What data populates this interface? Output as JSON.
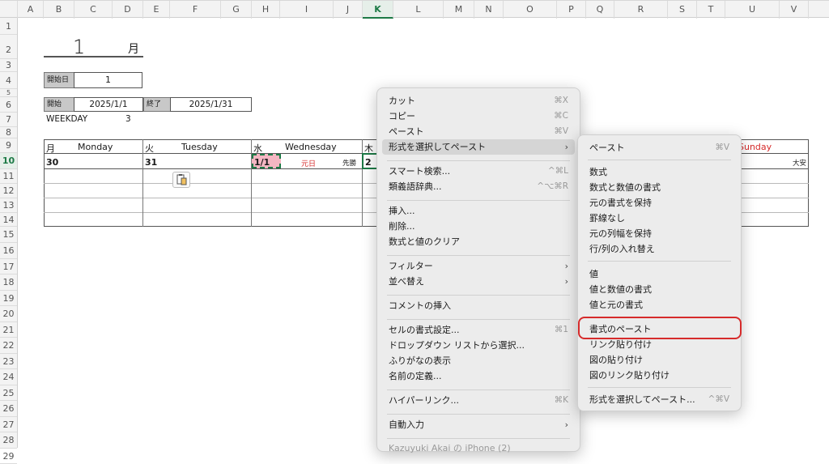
{
  "columns": [
    "A",
    "B",
    "C",
    "D",
    "E",
    "F",
    "G",
    "H",
    "I",
    "J",
    "K",
    "L",
    "M",
    "N",
    "O",
    "P",
    "Q",
    "R",
    "S",
    "T",
    "U",
    "V"
  ],
  "selected_column": "K",
  "rows": [
    "1",
    "2",
    "3",
    "4",
    "5",
    "6",
    "7",
    "8",
    "9",
    "10",
    "11",
    "12",
    "13",
    "14",
    "15",
    "16",
    "17",
    "18",
    "19",
    "20",
    "21",
    "22",
    "23",
    "24",
    "25",
    "26",
    "27",
    "28",
    "29"
  ],
  "selected_row": "10",
  "sheet": {
    "month_number": "1",
    "month_label": "月",
    "start_day_label": "開始日",
    "start_day_value": "1",
    "start_label": "開始",
    "start_value": "2025/1/1",
    "end_label": "終了",
    "end_value": "2025/1/31",
    "weekday_label": "WEEKDAY",
    "weekday_value": "3",
    "days": [
      {
        "kanji": "月",
        "name": "Monday"
      },
      {
        "kanji": "火",
        "name": "Tuesday"
      },
      {
        "kanji": "水",
        "name": "Wednesday"
      },
      {
        "kanji": "木",
        "name": ""
      }
    ],
    "sunday_label": "Sunday",
    "date_mon": "30",
    "date_tue": "31",
    "date_wed": "1/1",
    "holiday": "元日",
    "rokuyo_wed": "先勝",
    "date_thu": "2",
    "rokuyo_sun": "大安"
  },
  "context_menu": {
    "items": [
      {
        "label": "カット",
        "shortcut": "⌘X"
      },
      {
        "label": "コピー",
        "shortcut": "⌘C"
      },
      {
        "label": "ペースト",
        "shortcut": "⌘V"
      },
      {
        "label": "形式を選択してペースト",
        "arrow": "›"
      },
      {
        "label": "スマート検索...",
        "shortcut": "^⌘L"
      },
      {
        "label": "類義語辞典...",
        "shortcut": "^⌥⌘R"
      },
      {
        "label": "挿入..."
      },
      {
        "label": "削除..."
      },
      {
        "label": "数式と値のクリア"
      },
      {
        "label": "フィルター",
        "arrow": "›"
      },
      {
        "label": "並べ替え",
        "arrow": "›"
      },
      {
        "label": "コメントの挿入"
      },
      {
        "label": "セルの書式設定...",
        "shortcut": "⌘1"
      },
      {
        "label": "ドロップダウン リストから選択..."
      },
      {
        "label": "ふりがなの表示"
      },
      {
        "label": "名前の定義..."
      },
      {
        "label": "ハイパーリンク...",
        "shortcut": "⌘K"
      },
      {
        "label": "自動入力",
        "arrow": "›"
      },
      {
        "label": "Kazuyuki Akai の iPhone (2)"
      }
    ]
  },
  "submenu": {
    "items": [
      {
        "label": "ペースト",
        "shortcut": "⌘V"
      },
      {
        "label": "数式"
      },
      {
        "label": "数式と数値の書式"
      },
      {
        "label": "元の書式を保持"
      },
      {
        "label": "罫線なし"
      },
      {
        "label": "元の列幅を保持"
      },
      {
        "label": "行/列の入れ替え"
      },
      {
        "label": "値"
      },
      {
        "label": "値と数値の書式"
      },
      {
        "label": "値と元の書式"
      },
      {
        "label": "書式のペースト"
      },
      {
        "label": "リンク貼り付け"
      },
      {
        "label": "図の貼り付け"
      },
      {
        "label": "図のリンク貼り付け"
      },
      {
        "label": "形式を選択してペースト...",
        "shortcut": "^⌘V"
      }
    ]
  },
  "colors": {
    "accent": "#1d7a46",
    "highlight_ring": "#d62b2b",
    "holiday": "#d62b2b",
    "pink_cell": "#f4b6c2"
  }
}
